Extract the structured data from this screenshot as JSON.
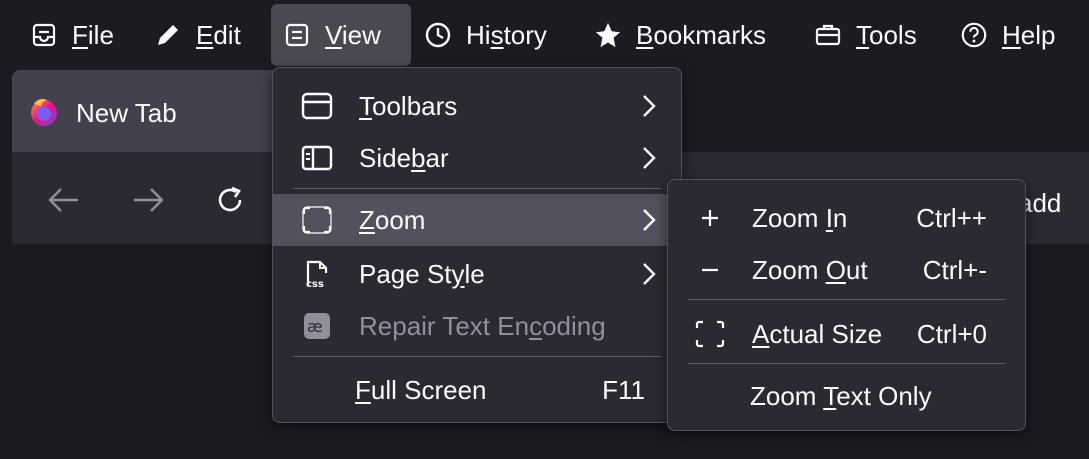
{
  "menubar": {
    "items": [
      {
        "label_pre": "",
        "label_acc": "F",
        "label_post": "ile",
        "icon": "file-icon"
      },
      {
        "label_pre": "",
        "label_acc": "E",
        "label_post": "dit",
        "icon": "pencil-icon"
      },
      {
        "label_pre": "",
        "label_acc": "V",
        "label_post": "iew",
        "icon": "view-icon"
      },
      {
        "label_pre": "Hi",
        "label_acc": "s",
        "label_post": "tory",
        "icon": "clock-icon"
      },
      {
        "label_pre": "",
        "label_acc": "B",
        "label_post": "ookmarks",
        "icon": "star-icon"
      },
      {
        "label_pre": "",
        "label_acc": "T",
        "label_post": "ools",
        "icon": "toolbox-icon"
      },
      {
        "label_pre": "",
        "label_acc": "H",
        "label_post": "elp",
        "icon": "help-icon"
      }
    ]
  },
  "tab": {
    "title": "New Tab",
    "icon": "firefox-icon"
  },
  "navbar": {
    "url_partial": "add"
  },
  "view_menu": {
    "items": [
      {
        "pre": "",
        "acc": "T",
        "post": "oolbars",
        "icon": "toolbars-icon"
      },
      {
        "pre": "Side",
        "acc": "b",
        "post": "ar",
        "icon": "sidebar-icon"
      },
      {
        "pre": "",
        "acc": "Z",
        "post": "oom",
        "icon": "zoom-icon"
      },
      {
        "pre": "Page St",
        "acc": "y",
        "post": "le",
        "icon": "css-icon"
      },
      {
        "pre": "Repair Text En",
        "acc": "c",
        "post": "oding",
        "icon": "text-encoding-icon"
      },
      {
        "pre": "",
        "acc": "F",
        "post": "ull Screen",
        "shortcut": "F11"
      }
    ]
  },
  "zoom_menu": {
    "items": [
      {
        "pre": "Zoom ",
        "acc": "I",
        "post": "n",
        "shortcut": "Ctrl++",
        "icon": "plus-icon"
      },
      {
        "pre": "Zoom ",
        "acc": "O",
        "post": "ut",
        "shortcut": "Ctrl+-",
        "icon": "minus-icon"
      },
      {
        "pre": "",
        "acc": "A",
        "post": "ctual Size",
        "shortcut": "Ctrl+0",
        "icon": "actual-size-icon"
      },
      {
        "pre": "Zoom ",
        "acc": "T",
        "post": "ext Only"
      }
    ]
  },
  "colors": {
    "background": "#1c1b22",
    "menu_bg": "#2b2a33",
    "hover": "#52525e",
    "disabled_text": "#8f8f9d"
  }
}
